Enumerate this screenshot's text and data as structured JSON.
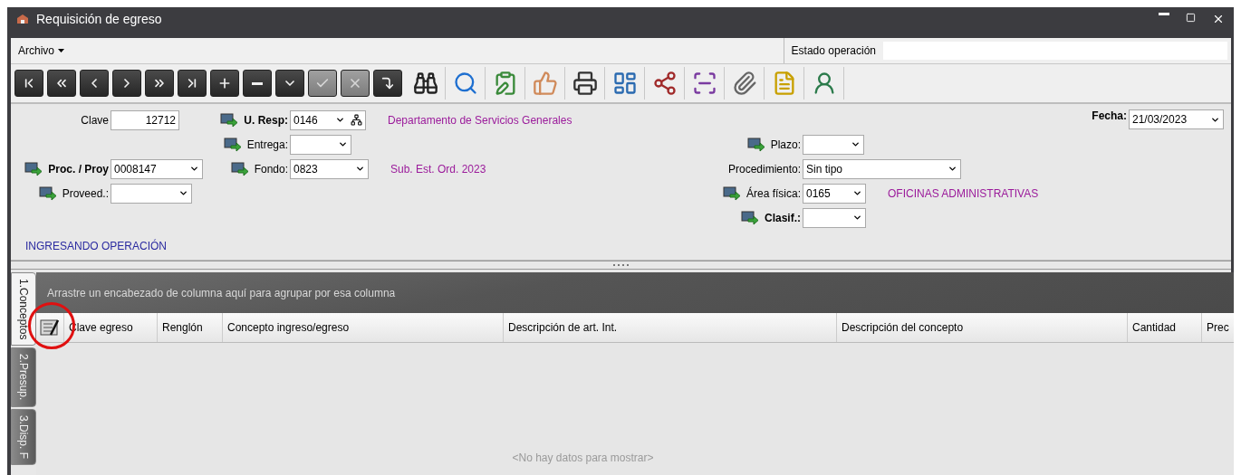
{
  "window": {
    "title": "Requisición de egreso"
  },
  "menu": {
    "items": [
      {
        "label": "Archivo"
      }
    ],
    "status_label": "Estado operación"
  },
  "toolbar": [
    {
      "kind": "nav",
      "disabled": false
    },
    {
      "kind": "nav",
      "disabled": false
    },
    {
      "kind": "nav",
      "disabled": false
    },
    {
      "kind": "nav",
      "disabled": false
    },
    {
      "kind": "nav",
      "disabled": false
    },
    {
      "kind": "nav",
      "disabled": false
    },
    {
      "kind": "nav",
      "disabled": false
    },
    {
      "kind": "nav",
      "disabled": false
    },
    {
      "kind": "nav",
      "disabled": false
    },
    {
      "kind": "nav",
      "disabled": true
    },
    {
      "kind": "nav",
      "disabled": true
    },
    {
      "kind": "nav",
      "disabled": false
    },
    {
      "kind": "tool",
      "disabled": false
    },
    {
      "kind": "tool",
      "disabled": false
    },
    {
      "kind": "tool",
      "disabled": false
    },
    {
      "kind": "tool",
      "disabled": false
    },
    {
      "kind": "tool",
      "disabled": false
    },
    {
      "kind": "tool",
      "disabled": false
    },
    {
      "kind": "tool",
      "disabled": false
    },
    {
      "kind": "tool",
      "disabled": false
    },
    {
      "kind": "tool",
      "disabled": false
    },
    {
      "kind": "tool",
      "disabled": false
    },
    {
      "kind": "tool",
      "disabled": false
    }
  ],
  "form": {
    "left_rows": [
      {
        "primary": {
          "label": "Clave",
          "value": "12712",
          "kind": "text",
          "bold": false,
          "linked": false
        },
        "secondary": {
          "label": "U. Resp:",
          "value": "0146",
          "kind": "combo",
          "bold": true,
          "linked": true,
          "lookup": true,
          "description": "Departamento de Servicios Generales"
        }
      },
      {
        "secondary": {
          "label": "Entrega:",
          "kind": "combo",
          "bold": false,
          "linked": true
        }
      },
      {
        "primary": {
          "label": "Proc. / Proy",
          "value": "0008147",
          "kind": "combo",
          "bold": true,
          "linked": true
        },
        "secondary": {
          "label": "Fondo:",
          "value": "0823",
          "kind": "combo",
          "bold": false,
          "linked": true,
          "description": "Sub. Est. Ord. 2023"
        }
      },
      {
        "primary": {
          "label": "Proveed.:",
          "kind": "combo",
          "bold": false,
          "linked": true
        }
      }
    ],
    "right_rows": [
      {
        "label": "Plazo:",
        "kind": "combo",
        "bold": false,
        "linked": true
      },
      {
        "label": "Procedimiento:",
        "value": "Sin tipo",
        "kind": "combo",
        "bold": false,
        "linked": false
      },
      {
        "label": "Área física:",
        "value": "0165",
        "kind": "combo",
        "bold": false,
        "linked": true,
        "description": "OFICINAS ADMINISTRATIVAS"
      },
      {
        "label": "Clasif.:",
        "kind": "combo",
        "bold": true,
        "linked": true
      }
    ],
    "date": {
      "label": "Fecha:",
      "value": "21/03/2023",
      "kind": "combo",
      "bold": true,
      "linked": false
    },
    "status_message": "INGRESANDO OPERACIÓN"
  },
  "tabs": [
    {
      "label": "1.Conceptos",
      "selected": true
    },
    {
      "label": "2.Presup.",
      "selected": false
    },
    {
      "label": "3.Disp. F",
      "selected": false
    }
  ],
  "grid": {
    "group_hint": "Arrastre un encabezado de columna aquí para agrupar por esa columna",
    "columns": [
      "Clave egreso",
      "Renglón",
      "Concepto ingreso/egreso",
      "Descripción de art. Int.",
      "Descripción del concepto",
      "Cantidad",
      "Prec"
    ],
    "empty_text": "<No hay datos para mostrar>"
  },
  "annotation": {
    "kind": "circle"
  }
}
